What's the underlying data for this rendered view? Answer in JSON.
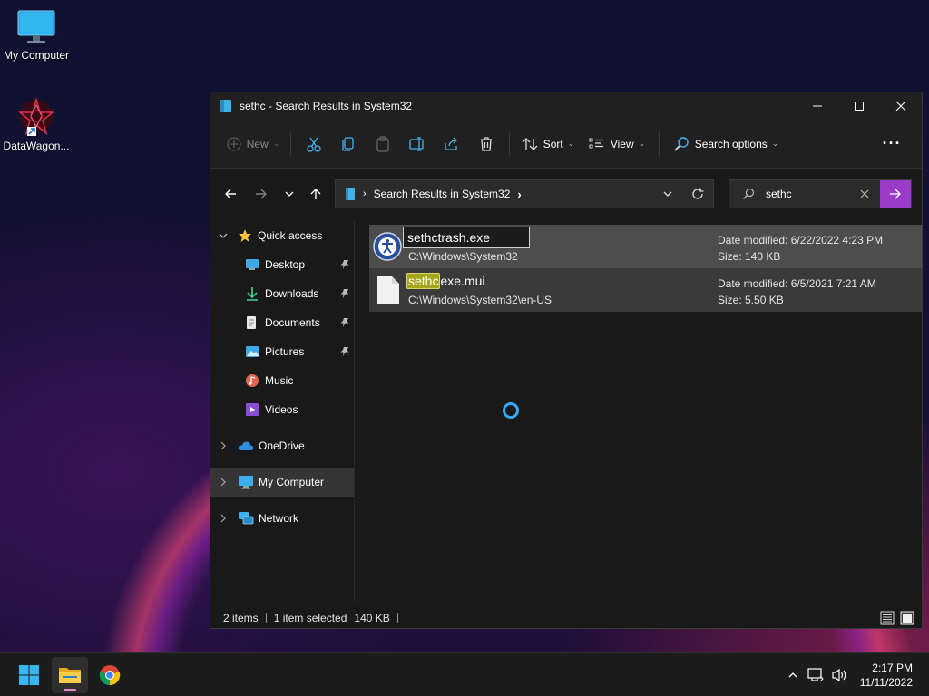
{
  "desktop": {
    "icons": [
      {
        "label": "My Computer"
      },
      {
        "label": "DataWagon..."
      }
    ]
  },
  "window": {
    "title": "sethc - Search Results in System32",
    "toolbar": {
      "new_label": "New",
      "sort_label": "Sort",
      "view_label": "View",
      "search_options_label": "Search options"
    },
    "address": {
      "crumb": "Search Results in System32"
    },
    "search": {
      "value": "sethc"
    },
    "sidebar": {
      "quick_access": "Quick access",
      "items": [
        {
          "label": "Desktop",
          "pinned": true
        },
        {
          "label": "Downloads",
          "pinned": true
        },
        {
          "label": "Documents",
          "pinned": true
        },
        {
          "label": "Pictures",
          "pinned": true
        },
        {
          "label": "Music",
          "pinned": false
        },
        {
          "label": "Videos",
          "pinned": false
        }
      ],
      "onedrive": "OneDrive",
      "my_computer": "My Computer",
      "network": "Network"
    },
    "results": [
      {
        "rename_value": "sethctrash.exe",
        "path": "C:\\Windows\\System32",
        "date_modified": "Date modified: 6/22/2022 4:23 PM",
        "size": "Size: 140 KB"
      },
      {
        "name_highlight": "sethc",
        "name_rest": "exe.mui",
        "path": "C:\\Windows\\System32\\en-US",
        "date_modified": "Date modified: 6/5/2021 7:21 AM",
        "size": "Size: 5.50 KB"
      }
    ],
    "status": {
      "count": "2 items",
      "selection": "1 item selected",
      "size": "140 KB"
    }
  },
  "taskbar": {
    "time": "2:17 PM",
    "date": "11/11/2022"
  },
  "colors": {
    "accent": "#9b3cc8",
    "highlight": "#a6a61a",
    "folder": "#f3c13a",
    "window_bg": "#191919"
  }
}
